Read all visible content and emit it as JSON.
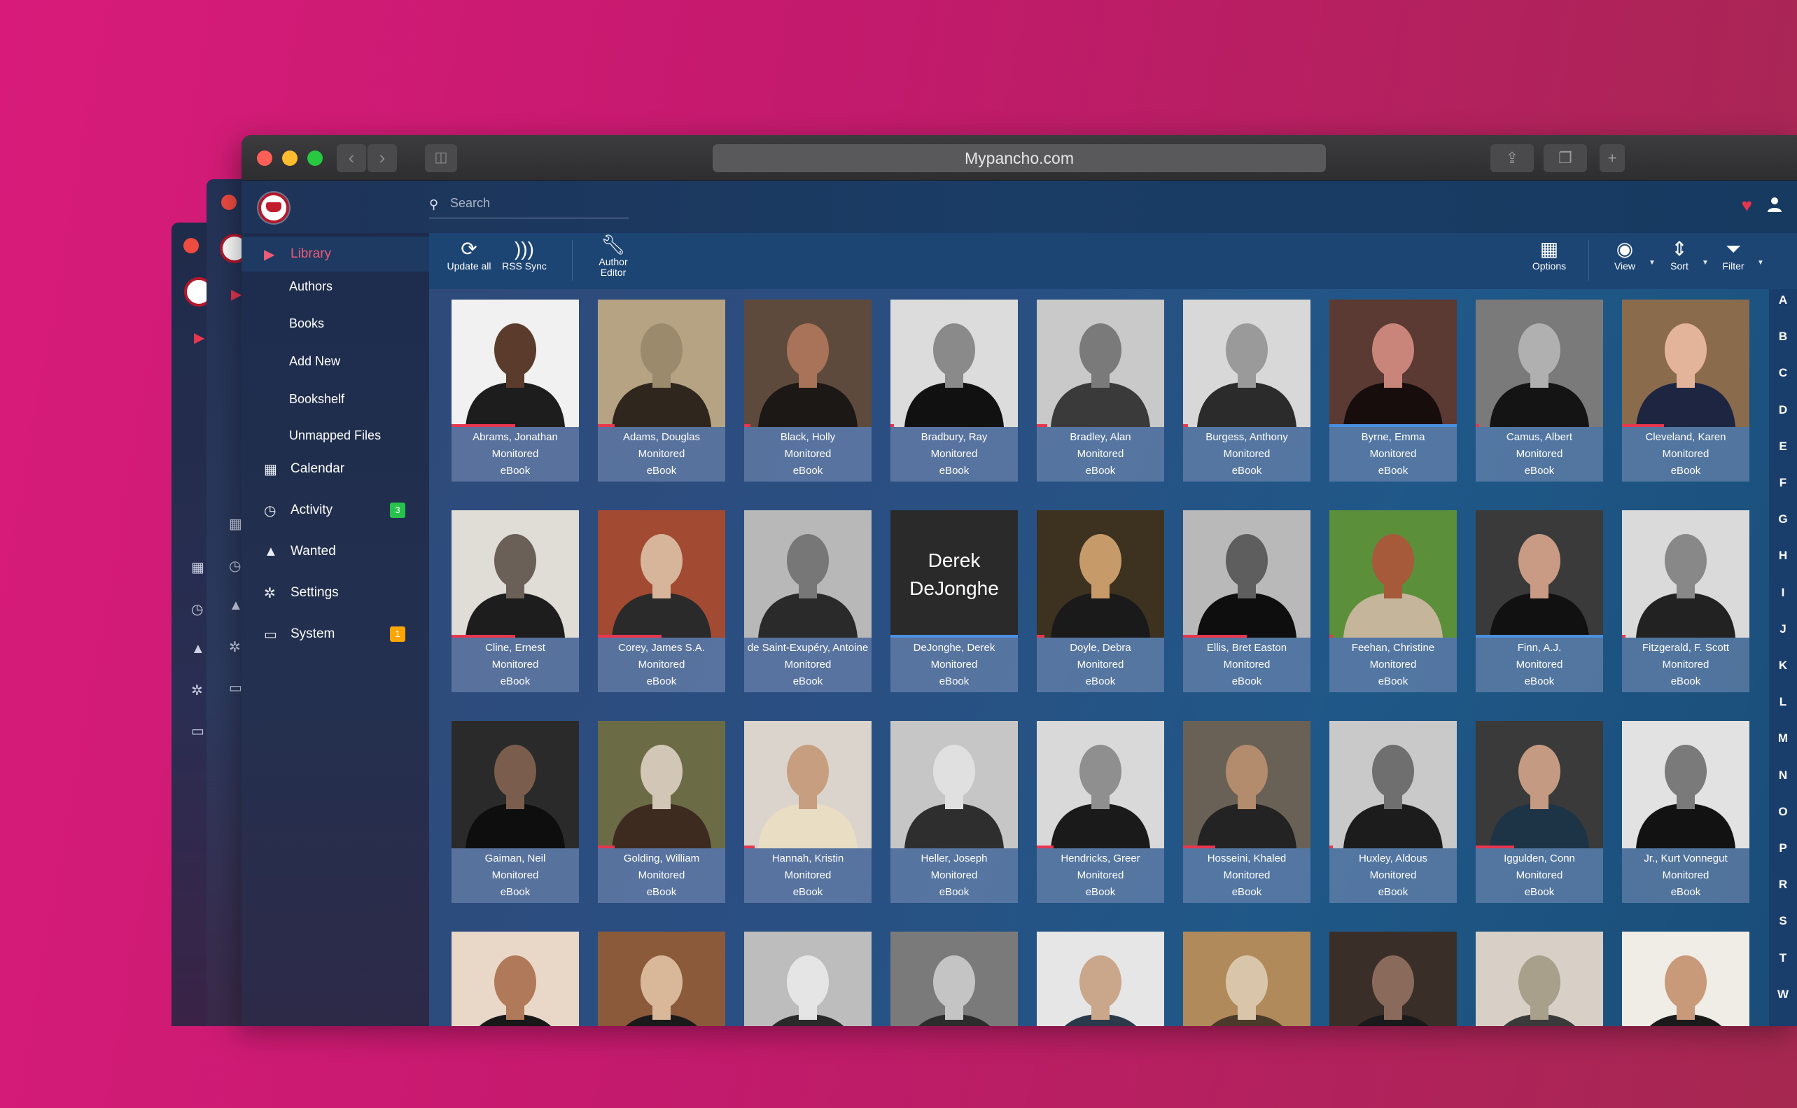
{
  "browser": {
    "url": "Mypancho.com"
  },
  "search": {
    "placeholder": "Search"
  },
  "sidebar": {
    "library": "Library",
    "sub": [
      "Authors",
      "Books",
      "Add New",
      "Bookshelf",
      "Unmapped Files"
    ],
    "calendar": "Calendar",
    "activity": "Activity",
    "activity_badge": "3",
    "wanted": "Wanted",
    "settings": "Settings",
    "system": "System",
    "system_badge": "1"
  },
  "toolbar": {
    "update_all": "Update all",
    "rss_sync": "RSS Sync",
    "author_editor_1": "Author",
    "author_editor_2": "Editor",
    "options": "Options",
    "view": "View",
    "sort": "Sort",
    "filter": "Filter"
  },
  "alphabet": [
    "A",
    "B",
    "C",
    "D",
    "E",
    "F",
    "G",
    "H",
    "I",
    "J",
    "K",
    "L",
    "M",
    "N",
    "O",
    "P",
    "R",
    "S",
    "T",
    "W"
  ],
  "authors": [
    {
      "name": "Abrams, Jonathan",
      "status": "Monitored",
      "type": "eBook",
      "bar": "#e8364f",
      "progress": 0.5
    },
    {
      "name": "Adams, Douglas",
      "status": "Monitored",
      "type": "eBook",
      "bar": "#e8364f",
      "progress": 0.13
    },
    {
      "name": "Black, Holly",
      "status": "Monitored",
      "type": "eBook",
      "bar": "#e8364f",
      "progress": 0.05
    },
    {
      "name": "Bradbury, Ray",
      "status": "Monitored",
      "type": "eBook",
      "bar": "#e8364f",
      "progress": 0.03
    },
    {
      "name": "Bradley, Alan",
      "status": "Monitored",
      "type": "eBook",
      "bar": "#e8364f",
      "progress": 0.08
    },
    {
      "name": "Burgess, Anthony",
      "status": "Monitored",
      "type": "eBook",
      "bar": "#e8364f",
      "progress": 0.04
    },
    {
      "name": "Byrne, Emma",
      "status": "Monitored",
      "type": "eBook",
      "bar": "#4a8fe0",
      "progress": 1.0
    },
    {
      "name": "Camus, Albert",
      "status": "Monitored",
      "type": "eBook",
      "bar": "#e8364f",
      "progress": 0.03
    },
    {
      "name": "Cleveland, Karen",
      "status": "Monitored",
      "type": "eBook",
      "bar": "#e8364f",
      "progress": 0.33
    },
    {
      "name": "Cline, Ernest",
      "status": "Monitored",
      "type": "eBook",
      "bar": "#e8364f",
      "progress": 0.5
    },
    {
      "name": "Corey, James S.A.",
      "status": "Monitored",
      "type": "eBook",
      "bar": "#e8364f",
      "progress": 0.5
    },
    {
      "name": "de Saint-Exupéry, Antoine",
      "status": "Monitored",
      "type": "eBook",
      "bar": "#e8364f",
      "progress": 0.0
    },
    {
      "name": "DeJonghe, Derek",
      "status": "Monitored",
      "type": "eBook",
      "bar": "#4a8fe0",
      "progress": 1.0
    },
    {
      "name": "Doyle, Debra",
      "status": "Monitored",
      "type": "eBook",
      "bar": "#e8364f",
      "progress": 0.06
    },
    {
      "name": "Ellis, Bret Easton",
      "status": "Monitored",
      "type": "eBook",
      "bar": "#e8364f",
      "progress": 0.5
    },
    {
      "name": "Feehan, Christine",
      "status": "Monitored",
      "type": "eBook",
      "bar": "#e8364f",
      "progress": 0.03
    },
    {
      "name": "Finn, A.J.",
      "status": "Monitored",
      "type": "eBook",
      "bar": "#4a8fe0",
      "progress": 1.0
    },
    {
      "name": "Fitzgerald, F. Scott",
      "status": "Monitored",
      "type": "eBook",
      "bar": "#e8364f",
      "progress": 0.03
    },
    {
      "name": "Gaiman, Neil",
      "status": "Monitored",
      "type": "eBook",
      "bar": "#e8364f",
      "progress": 0.0
    },
    {
      "name": "Golding, William",
      "status": "Monitored",
      "type": "eBook",
      "bar": "#e8364f",
      "progress": 0.13
    },
    {
      "name": "Hannah, Kristin",
      "status": "Monitored",
      "type": "eBook",
      "bar": "#e8364f",
      "progress": 0.08
    },
    {
      "name": "Heller, Joseph",
      "status": "Monitored",
      "type": "eBook",
      "bar": "#e8364f",
      "progress": 0.0
    },
    {
      "name": "Hendricks, Greer",
      "status": "Monitored",
      "type": "eBook",
      "bar": "#e8364f",
      "progress": 0.13
    },
    {
      "name": "Hosseini, Khaled",
      "status": "Monitored",
      "type": "eBook",
      "bar": "#e8364f",
      "progress": 0.25
    },
    {
      "name": "Huxley, Aldous",
      "status": "Monitored",
      "type": "eBook",
      "bar": "#e8364f",
      "progress": 0.03
    },
    {
      "name": "Iggulden, Conn",
      "status": "Monitored",
      "type": "eBook",
      "bar": "#e8364f",
      "progress": 0.3
    },
    {
      "name": "Jr., Kurt Vonnegut",
      "status": "Monitored",
      "type": "eBook",
      "bar": "#e8364f",
      "progress": 0.0
    },
    {
      "name": "",
      "status": "",
      "type": "",
      "bar": "",
      "progress": 0
    },
    {
      "name": "",
      "status": "",
      "type": "",
      "bar": "",
      "progress": 0
    },
    {
      "name": "",
      "status": "",
      "type": "",
      "bar": "",
      "progress": 0
    },
    {
      "name": "",
      "status": "",
      "type": "",
      "bar": "",
      "progress": 0
    },
    {
      "name": "",
      "status": "",
      "type": "",
      "bar": "",
      "progress": 0
    },
    {
      "name": "",
      "status": "",
      "type": "",
      "bar": "",
      "progress": 0
    },
    {
      "name": "",
      "status": "",
      "type": "",
      "bar": "",
      "progress": 0
    },
    {
      "name": "",
      "status": "",
      "type": "",
      "bar": "",
      "progress": 0
    },
    {
      "name": "",
      "status": "",
      "type": "",
      "bar": "",
      "progress": 0
    }
  ],
  "placeholder_poster": {
    "line1": "Derek",
    "line2": "DeJonghe"
  },
  "colors": {
    "accent": "#e8364f",
    "activity_badge": "#27c24c",
    "system_badge": "#ffa500"
  }
}
